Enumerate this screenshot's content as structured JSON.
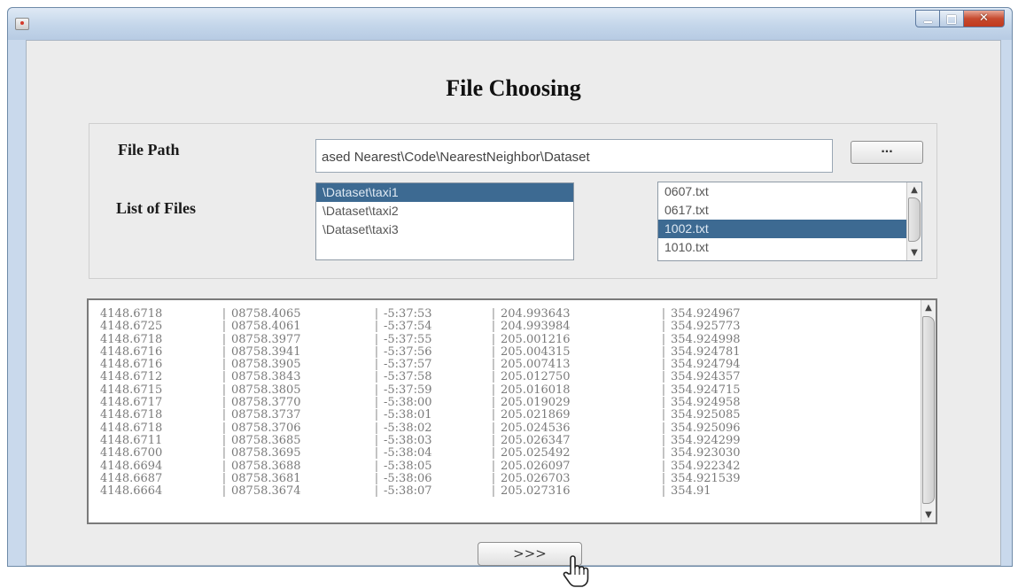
{
  "window": {
    "icon": "java-app-icon"
  },
  "heading": "File Choosing",
  "file_path": {
    "label": "File Path",
    "value": "ased Nearest\\Code\\NearestNeighbor\\Dataset",
    "browse_label": "..."
  },
  "list_of_files": {
    "label": "List of Files",
    "folders": [
      {
        "label": "\\Dataset\\taxi1",
        "selected": true
      },
      {
        "label": "\\Dataset\\taxi2",
        "selected": false
      },
      {
        "label": "\\Dataset\\taxi3",
        "selected": false
      }
    ],
    "files": [
      {
        "label": "0607.txt",
        "selected": false
      },
      {
        "label": "0617.txt",
        "selected": false
      },
      {
        "label": "1002.txt",
        "selected": true
      },
      {
        "label": "1010.txt",
        "selected": false
      }
    ]
  },
  "data_rows": [
    [
      "4148.6718",
      "08758.4065",
      "-5:37:53",
      "204.993643",
      "354.924967"
    ],
    [
      "4148.6725",
      "08758.4061",
      "-5:37:54",
      "204.993984",
      "354.925773"
    ],
    [
      "4148.6718",
      "08758.3977",
      "-5:37:55",
      "205.001216",
      "354.924998"
    ],
    [
      "4148.6716",
      "08758.3941",
      "-5:37:56",
      "205.004315",
      "354.924781"
    ],
    [
      "4148.6716",
      "08758.3905",
      "-5:37:57",
      "205.007413",
      "354.924794"
    ],
    [
      "4148.6712",
      "08758.3843",
      "-5:37:58",
      "205.012750",
      "354.924357"
    ],
    [
      "4148.6715",
      "08758.3805",
      "-5:37:59",
      "205.016018",
      "354.924715"
    ],
    [
      "4148.6717",
      "08758.3770",
      "-5:38:00",
      "205.019029",
      "354.924958"
    ],
    [
      "4148.6718",
      "08758.3737",
      "-5:38:01",
      "205.021869",
      "354.925085"
    ],
    [
      "4148.6718",
      "08758.3706",
      "-5:38:02",
      "205.024536",
      "354.925096"
    ],
    [
      "4148.6711",
      "08758.3685",
      "-5:38:03",
      "205.026347",
      "354.924299"
    ],
    [
      "4148.6700",
      "08758.3695",
      "-5:38:04",
      "205.025492",
      "354.923030"
    ],
    [
      "4148.6694",
      "08758.3688",
      "-5:38:05",
      "205.026097",
      "354.922342"
    ],
    [
      "4148.6687",
      "08758.3681",
      "-5:38:06",
      "205.026703",
      "354.921539"
    ],
    [
      "4148.6664",
      "08758.3674",
      "-5:38:07",
      "205.027316",
      "354.91"
    ]
  ],
  "next_button": ">>>",
  "cursor_icon": "hand-pointer-icon"
}
